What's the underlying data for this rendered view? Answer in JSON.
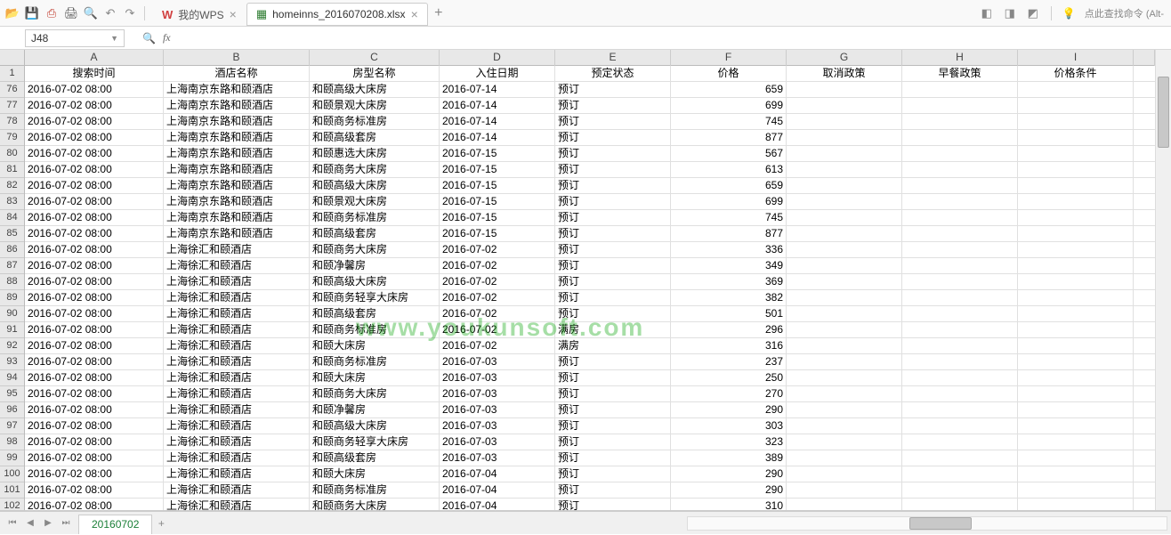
{
  "toolbar": {
    "hint": "点此查找命令 (Alt-"
  },
  "tabs": {
    "wps_label": "我的WPS",
    "file_label": "homeinns_2016070208.xlsx"
  },
  "namebox": {
    "value": "J48"
  },
  "columns": {
    "letters": [
      "A",
      "B",
      "C",
      "D",
      "E",
      "F",
      "G",
      "H",
      "I"
    ],
    "widths": [
      156,
      164,
      146,
      130,
      130,
      130,
      130,
      130,
      130
    ],
    "headers": [
      "搜索时间",
      "酒店名称",
      "房型名称",
      "入住日期",
      "预定状态",
      "价格",
      "取消政策",
      "早餐政策",
      "价格条件"
    ]
  },
  "row_start": 76,
  "row_header_first": 1,
  "rows": [
    {
      "n": 76,
      "t": "2016-07-02 08:00",
      "h": "上海南京东路和颐酒店",
      "r": "和颐高级大床房",
      "d": "2016-07-14",
      "s": "预订",
      "p": 659
    },
    {
      "n": 77,
      "t": "2016-07-02 08:00",
      "h": "上海南京东路和颐酒店",
      "r": "和颐景观大床房",
      "d": "2016-07-14",
      "s": "预订",
      "p": 699
    },
    {
      "n": 78,
      "t": "2016-07-02 08:00",
      "h": "上海南京东路和颐酒店",
      "r": "和颐商务标准房",
      "d": "2016-07-14",
      "s": "预订",
      "p": 745
    },
    {
      "n": 79,
      "t": "2016-07-02 08:00",
      "h": "上海南京东路和颐酒店",
      "r": "和颐高级套房",
      "d": "2016-07-14",
      "s": "预订",
      "p": 877
    },
    {
      "n": 80,
      "t": "2016-07-02 08:00",
      "h": "上海南京东路和颐酒店",
      "r": "和颐惠选大床房",
      "d": "2016-07-15",
      "s": "预订",
      "p": 567
    },
    {
      "n": 81,
      "t": "2016-07-02 08:00",
      "h": "上海南京东路和颐酒店",
      "r": "和颐商务大床房",
      "d": "2016-07-15",
      "s": "预订",
      "p": 613
    },
    {
      "n": 82,
      "t": "2016-07-02 08:00",
      "h": "上海南京东路和颐酒店",
      "r": "和颐高级大床房",
      "d": "2016-07-15",
      "s": "预订",
      "p": 659
    },
    {
      "n": 83,
      "t": "2016-07-02 08:00",
      "h": "上海南京东路和颐酒店",
      "r": "和颐景观大床房",
      "d": "2016-07-15",
      "s": "预订",
      "p": 699
    },
    {
      "n": 84,
      "t": "2016-07-02 08:00",
      "h": "上海南京东路和颐酒店",
      "r": "和颐商务标准房",
      "d": "2016-07-15",
      "s": "预订",
      "p": 745
    },
    {
      "n": 85,
      "t": "2016-07-02 08:00",
      "h": "上海南京东路和颐酒店",
      "r": "和颐高级套房",
      "d": "2016-07-15",
      "s": "预订",
      "p": 877
    },
    {
      "n": 86,
      "t": "2016-07-02 08:00",
      "h": "上海徐汇和颐酒店",
      "r": "和颐商务大床房",
      "d": "2016-07-02",
      "s": "预订",
      "p": 336
    },
    {
      "n": 87,
      "t": "2016-07-02 08:00",
      "h": "上海徐汇和颐酒店",
      "r": "和颐净馨房",
      "d": "2016-07-02",
      "s": "预订",
      "p": 349
    },
    {
      "n": 88,
      "t": "2016-07-02 08:00",
      "h": "上海徐汇和颐酒店",
      "r": "和颐高级大床房",
      "d": "2016-07-02",
      "s": "预订",
      "p": 369
    },
    {
      "n": 89,
      "t": "2016-07-02 08:00",
      "h": "上海徐汇和颐酒店",
      "r": "和颐商务轻享大床房",
      "d": "2016-07-02",
      "s": "预订",
      "p": 382
    },
    {
      "n": 90,
      "t": "2016-07-02 08:00",
      "h": "上海徐汇和颐酒店",
      "r": "和颐高级套房",
      "d": "2016-07-02",
      "s": "预订",
      "p": 501
    },
    {
      "n": 91,
      "t": "2016-07-02 08:00",
      "h": "上海徐汇和颐酒店",
      "r": "和颐商务标准房",
      "d": "2016-07-02",
      "s": "满房",
      "p": 296
    },
    {
      "n": 92,
      "t": "2016-07-02 08:00",
      "h": "上海徐汇和颐酒店",
      "r": "和颐大床房",
      "d": "2016-07-02",
      "s": "满房",
      "p": 316
    },
    {
      "n": 93,
      "t": "2016-07-02 08:00",
      "h": "上海徐汇和颐酒店",
      "r": "和颐商务标准房",
      "d": "2016-07-03",
      "s": "预订",
      "p": 237
    },
    {
      "n": 94,
      "t": "2016-07-02 08:00",
      "h": "上海徐汇和颐酒店",
      "r": "和颐大床房",
      "d": "2016-07-03",
      "s": "预订",
      "p": 250
    },
    {
      "n": 95,
      "t": "2016-07-02 08:00",
      "h": "上海徐汇和颐酒店",
      "r": "和颐商务大床房",
      "d": "2016-07-03",
      "s": "预订",
      "p": 270
    },
    {
      "n": 96,
      "t": "2016-07-02 08:00",
      "h": "上海徐汇和颐酒店",
      "r": "和颐净馨房",
      "d": "2016-07-03",
      "s": "预订",
      "p": 290
    },
    {
      "n": 97,
      "t": "2016-07-02 08:00",
      "h": "上海徐汇和颐酒店",
      "r": "和颐高级大床房",
      "d": "2016-07-03",
      "s": "预订",
      "p": 303
    },
    {
      "n": 98,
      "t": "2016-07-02 08:00",
      "h": "上海徐汇和颐酒店",
      "r": "和颐商务轻享大床房",
      "d": "2016-07-03",
      "s": "预订",
      "p": 323
    },
    {
      "n": 99,
      "t": "2016-07-02 08:00",
      "h": "上海徐汇和颐酒店",
      "r": "和颐高级套房",
      "d": "2016-07-03",
      "s": "预订",
      "p": 389
    },
    {
      "n": 100,
      "t": "2016-07-02 08:00",
      "h": "上海徐汇和颐酒店",
      "r": "和颐大床房",
      "d": "2016-07-04",
      "s": "预订",
      "p": 290
    },
    {
      "n": 101,
      "t": "2016-07-02 08:00",
      "h": "上海徐汇和颐酒店",
      "r": "和颐商务标准房",
      "d": "2016-07-04",
      "s": "预订",
      "p": 290
    },
    {
      "n": 102,
      "t": "2016-07-02 08:00",
      "h": "上海徐汇和颐酒店",
      "r": "和颐商务大床房",
      "d": "2016-07-04",
      "s": "预订",
      "p": 310
    }
  ],
  "sheet": {
    "name": "20160702"
  },
  "watermark": "www.youkunsoft.com"
}
